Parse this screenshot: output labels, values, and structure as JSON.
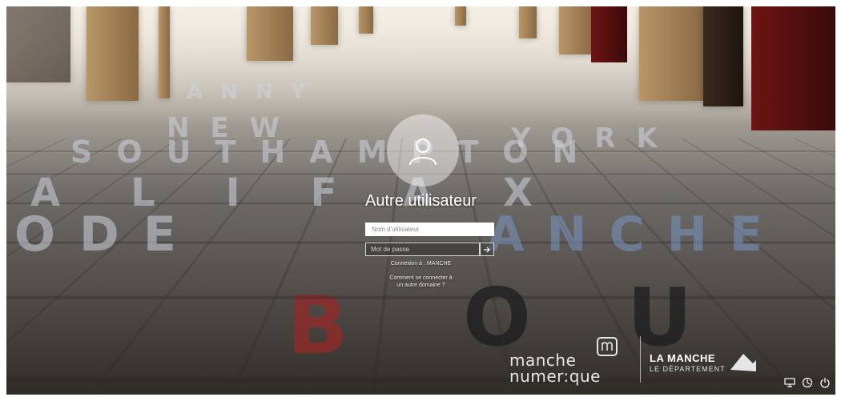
{
  "lock_screen": {
    "username": "Autre utilisateur",
    "username_placeholder": "Nom d'utilisateur",
    "password_placeholder": "Mot de passe",
    "signin_target": "Connexion à : MANCHE",
    "signin_help": "Comment se connecter à un autre domaine ?"
  },
  "background": {
    "floor_words": [
      "ANNY",
      "NEW",
      "YORK",
      "SOUTHAMPTON",
      "ALIFAX",
      "ODE",
      "ANCHE",
      "B",
      "OU"
    ]
  },
  "branding": {
    "manche_numerique_line1": "manche",
    "manche_numerique_line2": "numer:que",
    "department_title": "LA MANCHE",
    "department_subtitle": "LE DÉPARTEMENT"
  },
  "tray": {
    "network_icon": "network-icon",
    "accessibility_icon": "accessibility-icon",
    "power_icon": "power-icon"
  },
  "colors": {
    "accent_red": "#962828",
    "field_border": "#ffffff"
  }
}
